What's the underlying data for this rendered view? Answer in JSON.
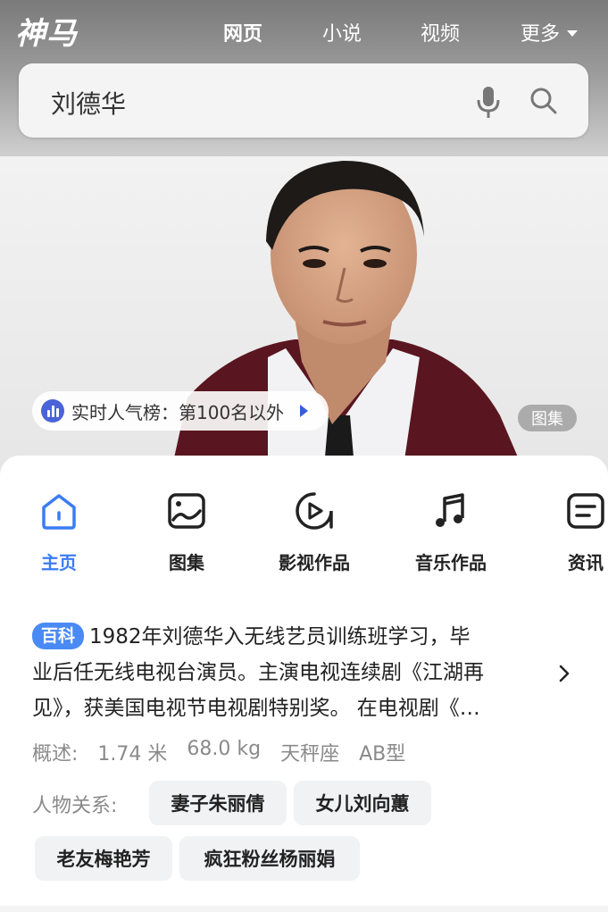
{
  "header": {
    "logo": "神马",
    "nav": [
      "网页",
      "小说",
      "视频"
    ],
    "more": "更多"
  },
  "search": {
    "query": "刘德华"
  },
  "hero": {
    "popularity": "实时人气榜：第100名以外",
    "gallery_badge": "图集"
  },
  "tabs": [
    {
      "label": "主页",
      "icon": "home-icon"
    },
    {
      "label": "图集",
      "icon": "image-icon"
    },
    {
      "label": "影视作品",
      "icon": "play-icon"
    },
    {
      "label": "音乐作品",
      "icon": "music-icon"
    },
    {
      "label": "资讯",
      "icon": "news-icon"
    }
  ],
  "summary": {
    "badge": "百科",
    "line1": "1982年刘德华入无线艺员训练班学习，毕",
    "line2": "业后任无线电视台演员。主演电视连续剧《江湖再",
    "line3": "见》，获美国电视节电视剧特别奖。 在电视剧《…"
  },
  "facts": {
    "label": "概述:",
    "height": "1.74 米",
    "weight": "68.0 kg",
    "zodiac": "天秤座",
    "blood": "AB型"
  },
  "relations": {
    "label": "人物关系:",
    "items": [
      "妻子朱丽倩",
      "女儿刘向蕙",
      "老友梅艳芳",
      "疯狂粉丝杨丽娟"
    ]
  },
  "colors": {
    "accent": "#3b7cf5",
    "badge": "#4a8af4"
  }
}
